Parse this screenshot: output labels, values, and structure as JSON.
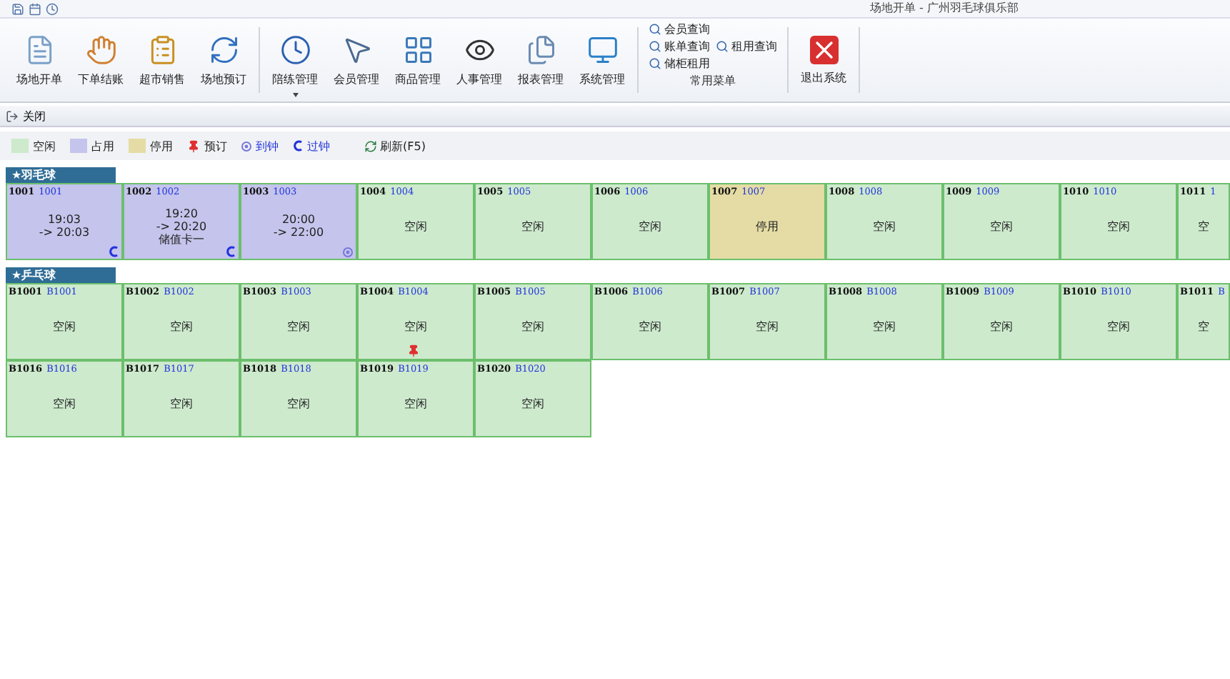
{
  "window": {
    "title": "场地开单 - 广州羽毛球俱乐部"
  },
  "ribbon": {
    "buttons": [
      {
        "kind": "page",
        "label": "场地开单"
      },
      {
        "kind": "hand",
        "label": "下单结账"
      },
      {
        "kind": "clipboard",
        "label": "超市销售"
      },
      {
        "kind": "refresh",
        "label": "场地预订"
      },
      {
        "kind": "clock",
        "label": "陪练管理",
        "dropdown": true
      },
      {
        "kind": "pointer",
        "label": "会员管理"
      },
      {
        "kind": "grid",
        "label": "商品管理"
      },
      {
        "kind": "eye",
        "label": "人事管理"
      },
      {
        "kind": "files",
        "label": "报表管理"
      },
      {
        "kind": "monitor",
        "label": "系统管理"
      }
    ],
    "menu_group": {
      "items": [
        "会员查询",
        "账单查询",
        "租用查询",
        "储柜租用"
      ],
      "label": "常用菜单"
    },
    "exit": "退出系统"
  },
  "close_bar": {
    "label": "关闭"
  },
  "legend": [
    {
      "kind": "swatch",
      "label": "空闲",
      "color": "#cdeacd"
    },
    {
      "kind": "swatch",
      "label": "占用",
      "color": "#c4c4ec"
    },
    {
      "kind": "swatch",
      "label": "停用",
      "color": "#e4dca4"
    },
    {
      "kind": "reserved",
      "label": "预订"
    },
    {
      "kind": "arrived",
      "label": "到钟"
    },
    {
      "kind": "overtime",
      "label": "过钟"
    },
    {
      "kind": "refresh",
      "label": "刷新(F5)"
    }
  ],
  "sections": [
    {
      "title": "★羽毛球",
      "courts": [
        {
          "code": "1001",
          "name": "1001",
          "kind": "occupied",
          "lines": [
            "19:03",
            "-> 20:03"
          ],
          "overtime": true
        },
        {
          "code": "1002",
          "name": "1002",
          "kind": "occupied",
          "lines": [
            "19:20",
            "-> 20:20",
            "储值卡一"
          ],
          "overtime": true
        },
        {
          "code": "1003",
          "name": "1003",
          "kind": "occupied",
          "lines": [
            "20:00",
            "-> 22:00"
          ],
          "arrived": true
        },
        {
          "code": "1004",
          "name": "1004",
          "kind": "free",
          "lines": [
            "空闲"
          ]
        },
        {
          "code": "1005",
          "name": "1005",
          "kind": "free",
          "lines": [
            "空闲"
          ]
        },
        {
          "code": "1006",
          "name": "1006",
          "kind": "free",
          "lines": [
            "空闲"
          ]
        },
        {
          "code": "1007",
          "name": "1007",
          "kind": "disabled",
          "lines": [
            "停用"
          ]
        },
        {
          "code": "1008",
          "name": "1008",
          "kind": "free",
          "lines": [
            "空闲"
          ]
        },
        {
          "code": "1009",
          "name": "1009",
          "kind": "free",
          "lines": [
            "空闲"
          ]
        },
        {
          "code": "1010",
          "name": "1010",
          "kind": "free",
          "lines": [
            "空闲"
          ]
        },
        {
          "code": "1011",
          "name": "1",
          "kind": "free",
          "lines": [
            "空"
          ]
        }
      ]
    },
    {
      "title": "★乒乓球",
      "courts": [
        {
          "code": "B1001",
          "name": "B1001",
          "kind": "free",
          "lines": [
            "空闲"
          ]
        },
        {
          "code": "B1002",
          "name": "B1002",
          "kind": "free",
          "lines": [
            "空闲"
          ]
        },
        {
          "code": "B1003",
          "name": "B1003",
          "kind": "free",
          "lines": [
            "空闲"
          ]
        },
        {
          "code": "B1004",
          "name": "B1004",
          "kind": "free",
          "lines": [
            "空闲"
          ],
          "reserved": true
        },
        {
          "code": "B1005",
          "name": "B1005",
          "kind": "free",
          "lines": [
            "空闲"
          ]
        },
        {
          "code": "B1006",
          "name": "B1006",
          "kind": "free",
          "lines": [
            "空闲"
          ]
        },
        {
          "code": "B1007",
          "name": "B1007",
          "kind": "free",
          "lines": [
            "空闲"
          ]
        },
        {
          "code": "B1008",
          "name": "B1008",
          "kind": "free",
          "lines": [
            "空闲"
          ]
        },
        {
          "code": "B1009",
          "name": "B1009",
          "kind": "free",
          "lines": [
            "空闲"
          ]
        },
        {
          "code": "B1010",
          "name": "B1010",
          "kind": "free",
          "lines": [
            "空闲"
          ]
        },
        {
          "code": "B1011",
          "name": "B",
          "kind": "free",
          "lines": [
            "空"
          ]
        },
        {
          "code": "B1016",
          "name": "B1016",
          "kind": "free",
          "lines": [
            "空闲"
          ]
        },
        {
          "code": "B1017",
          "name": "B1017",
          "kind": "free",
          "lines": [
            "空闲"
          ]
        },
        {
          "code": "B1018",
          "name": "B1018",
          "kind": "free",
          "lines": [
            "空闲"
          ]
        },
        {
          "code": "B1019",
          "name": "B1019",
          "kind": "free",
          "lines": [
            "空闲"
          ]
        },
        {
          "code": "B1020",
          "name": "B1020",
          "kind": "free",
          "lines": [
            "空闲"
          ]
        }
      ]
    }
  ]
}
